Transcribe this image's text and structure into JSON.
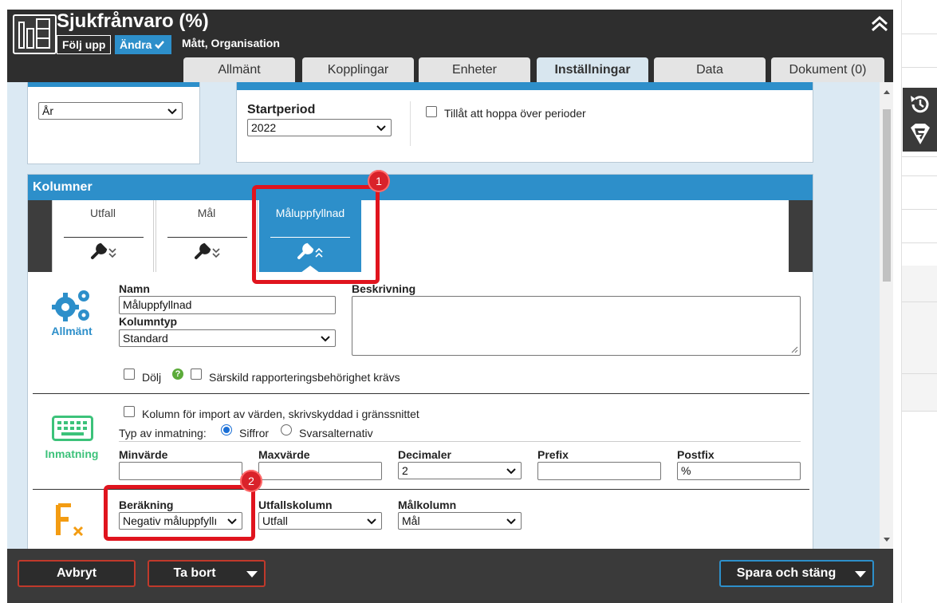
{
  "header": {
    "title": "Sjukfrånvaro (%)",
    "follow_label": "Följ upp",
    "change_label": "Ändra",
    "subtitle": "Mått, Organisation"
  },
  "tabs": [
    {
      "label": "Allmänt",
      "active": false
    },
    {
      "label": "Kopplingar",
      "active": false
    },
    {
      "label": "Enheter",
      "active": false
    },
    {
      "label": "Inställningar",
      "active": true
    },
    {
      "label": "Data",
      "active": false
    },
    {
      "label": "Dokument (0)",
      "active": false
    }
  ],
  "period": {
    "type_value": "År",
    "start_label": "Startperiod",
    "start_value": "2022",
    "skip_label": "Tillåt att hoppa över perioder"
  },
  "columns": {
    "header": "Kolumner",
    "tabs": [
      {
        "label": "Utfall"
      },
      {
        "label": "Mål"
      },
      {
        "label": "Måluppfyllnad"
      }
    ]
  },
  "general": {
    "section_label": "Allmänt",
    "name_label": "Namn",
    "name_value": "Måluppfyllnad",
    "type_label": "Kolumntyp",
    "type_value": "Standard",
    "desc_label": "Beskrivning",
    "hide_label": "Dölj",
    "special_label": "Särskild rapporteringsbehörighet krävs"
  },
  "input": {
    "section_label": "Inmatning",
    "import_label": "Kolumn för import av värden, skrivskyddad i gränssnittet",
    "type_label": "Typ av inmatning:",
    "opt_numbers": "Siffror",
    "opt_answers": "Svarsalternativ",
    "min_label": "Minvärde",
    "max_label": "Maxvärde",
    "dec_label": "Decimaler",
    "dec_value": "2",
    "prefix_label": "Prefix",
    "postfix_label": "Postfix",
    "postfix_value": "%"
  },
  "calc": {
    "calc_label": "Beräkning",
    "calc_value": "Negativ måluppfyllı",
    "outcome_label": "Utfallskolumn",
    "outcome_value": "Utfall",
    "goal_label": "Målkolumn",
    "goal_value": "Mål"
  },
  "footer": {
    "cancel": "Avbryt",
    "delete": "Ta bort",
    "save": "Spara och stäng"
  },
  "annotations": [
    "1",
    "2"
  ],
  "colors": {
    "accent": "#2d8fca",
    "dark": "#2e2e2e",
    "annotation_red": "#e0141e",
    "input_green": "#3cc27a",
    "calc_orange": "#f39c12"
  }
}
